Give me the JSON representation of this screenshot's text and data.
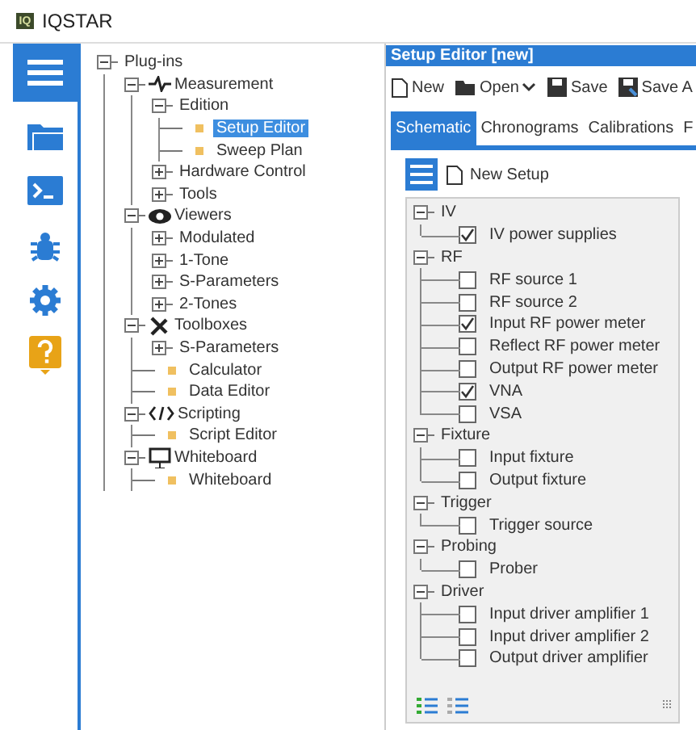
{
  "title_bar": {
    "logo": "IQ",
    "title": "IQSTAR"
  },
  "sidebar": {
    "items": [
      {
        "selected": true
      },
      {
        "selected": false
      },
      {
        "selected": false
      },
      {
        "selected": false
      },
      {
        "selected": false
      },
      {
        "selected": false
      }
    ]
  },
  "plugins_tree": {
    "label": "Plug-ins",
    "kind": "group",
    "expanded": true,
    "children": [
      {
        "label": "Measurement",
        "kind": "group",
        "expanded": true,
        "children": [
          {
            "label": "Edition",
            "kind": "group",
            "expanded": true,
            "children": [
              {
                "label": "Setup Editor",
                "kind": "leaf",
                "selected": true
              },
              {
                "label": "Sweep Plan",
                "kind": "leaf",
                "selected": false
              }
            ]
          },
          {
            "label": "Hardware Control",
            "kind": "group",
            "expanded": false
          },
          {
            "label": "Tools",
            "kind": "group",
            "expanded": false
          }
        ]
      },
      {
        "label": "Viewers",
        "kind": "group",
        "expanded": true,
        "children": [
          {
            "label": "Modulated",
            "kind": "group",
            "expanded": false
          },
          {
            "label": "1-Tone",
            "kind": "group",
            "expanded": false
          },
          {
            "label": "S-Parameters",
            "kind": "group",
            "expanded": false
          },
          {
            "label": "2-Tones",
            "kind": "group",
            "expanded": false
          }
        ]
      },
      {
        "label": "Toolboxes",
        "kind": "group",
        "expanded": true,
        "children": [
          {
            "label": "S-Parameters",
            "kind": "group",
            "expanded": false
          },
          {
            "label": "Calculator",
            "kind": "leaf",
            "selected": false
          },
          {
            "label": "Data Editor",
            "kind": "leaf",
            "selected": false
          }
        ]
      },
      {
        "label": "Scripting",
        "kind": "group",
        "expanded": true,
        "children": [
          {
            "label": "Script Editor",
            "kind": "leaf",
            "selected": false
          }
        ]
      },
      {
        "label": "Whiteboard",
        "kind": "group",
        "expanded": true,
        "children": [
          {
            "label": "Whiteboard",
            "kind": "leaf",
            "selected": false
          }
        ]
      }
    ]
  },
  "editor": {
    "title": "Setup Editor [new]",
    "toolbar": [
      {
        "label": "New",
        "kind": "plain"
      },
      {
        "label": "Open",
        "kind": "dropdown"
      },
      {
        "label": "Save",
        "kind": "plain"
      },
      {
        "label": "Save A",
        "kind": "plain"
      }
    ],
    "tabs": [
      {
        "label": "Schematic",
        "selected": true
      },
      {
        "label": "Chronograms",
        "selected": false
      },
      {
        "label": "Calibrations",
        "selected": false
      },
      {
        "label": "F",
        "selected": false
      }
    ],
    "new_setup": "New Setup",
    "setup_tree": [
      {
        "label": "IV",
        "expanded": true,
        "items": [
          {
            "label": "IV power supplies",
            "checked": true
          }
        ]
      },
      {
        "label": "RF",
        "expanded": true,
        "items": [
          {
            "label": "RF source 1",
            "checked": false
          },
          {
            "label": "RF source 2",
            "checked": false
          },
          {
            "label": "Input RF power meter",
            "checked": true
          },
          {
            "label": "Reflect RF power meter",
            "checked": false
          },
          {
            "label": "Output RF power meter",
            "checked": false
          },
          {
            "label": "VNA",
            "checked": true
          },
          {
            "label": "VSA",
            "checked": false
          }
        ]
      },
      {
        "label": "Fixture",
        "expanded": true,
        "items": [
          {
            "label": "Input fixture",
            "checked": false
          },
          {
            "label": "Output fixture",
            "checked": false
          }
        ]
      },
      {
        "label": "Trigger",
        "expanded": true,
        "items": [
          {
            "label": "Trigger source",
            "checked": false
          }
        ]
      },
      {
        "label": "Probing",
        "expanded": true,
        "items": [
          {
            "label": "Prober",
            "checked": false
          }
        ]
      },
      {
        "label": "Driver",
        "expanded": true,
        "items": [
          {
            "label": "Input driver amplifier 1",
            "checked": false
          },
          {
            "label": "Input driver amplifier 2",
            "checked": false
          },
          {
            "label": "Output driver amplifier",
            "checked": false
          }
        ]
      }
    ]
  }
}
